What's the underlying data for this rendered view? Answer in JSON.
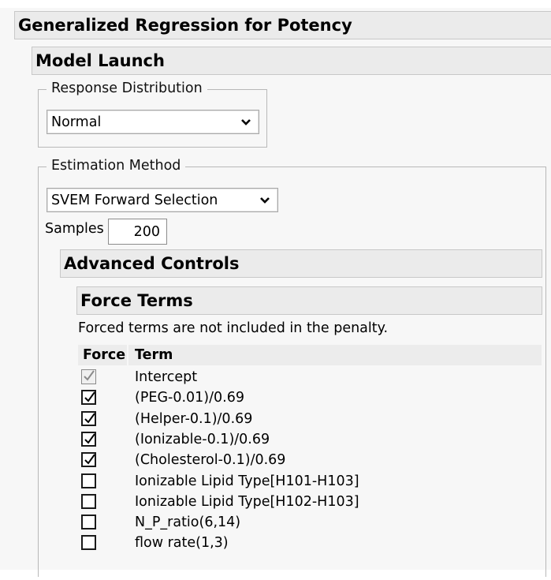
{
  "report": {
    "title": "Generalized Regression for Potency",
    "model_launch": {
      "title": "Model Launch",
      "response_distribution": {
        "legend": "Response Distribution",
        "selected": "Normal"
      },
      "estimation_method": {
        "legend": "Estimation Method",
        "selected": "SVEM Forward Selection",
        "samples_label": "Samples",
        "samples_value": "200",
        "advanced_controls": {
          "title": "Advanced Controls",
          "force_terms": {
            "title": "Force Terms",
            "note": "Forced terms are not included in the penalty.",
            "columns": {
              "force": "Force",
              "term": "Term"
            },
            "terms": [
              {
                "term": "Intercept",
                "checked": true,
                "disabled": true
              },
              {
                "term": "(PEG-0.01)/0.69",
                "checked": true,
                "disabled": false
              },
              {
                "term": "(Helper-0.1)/0.69",
                "checked": true,
                "disabled": false
              },
              {
                "term": "(Ionizable-0.1)/0.69",
                "checked": true,
                "disabled": false
              },
              {
                "term": "(Cholesterol-0.1)/0.69",
                "checked": true,
                "disabled": false
              },
              {
                "term": "Ionizable Lipid Type[H101-H103]",
                "checked": false,
                "disabled": false
              },
              {
                "term": "Ionizable Lipid Type[H102-H103]",
                "checked": false,
                "disabled": false
              },
              {
                "term": "N_P_ratio(6,14)",
                "checked": false,
                "disabled": false
              },
              {
                "term": "flow rate(1,3)",
                "checked": false,
                "disabled": false
              }
            ]
          }
        }
      }
    }
  },
  "icons": {
    "dropdown": "chevron-down-icon",
    "checkbox_checked": "checkmark-icon"
  }
}
